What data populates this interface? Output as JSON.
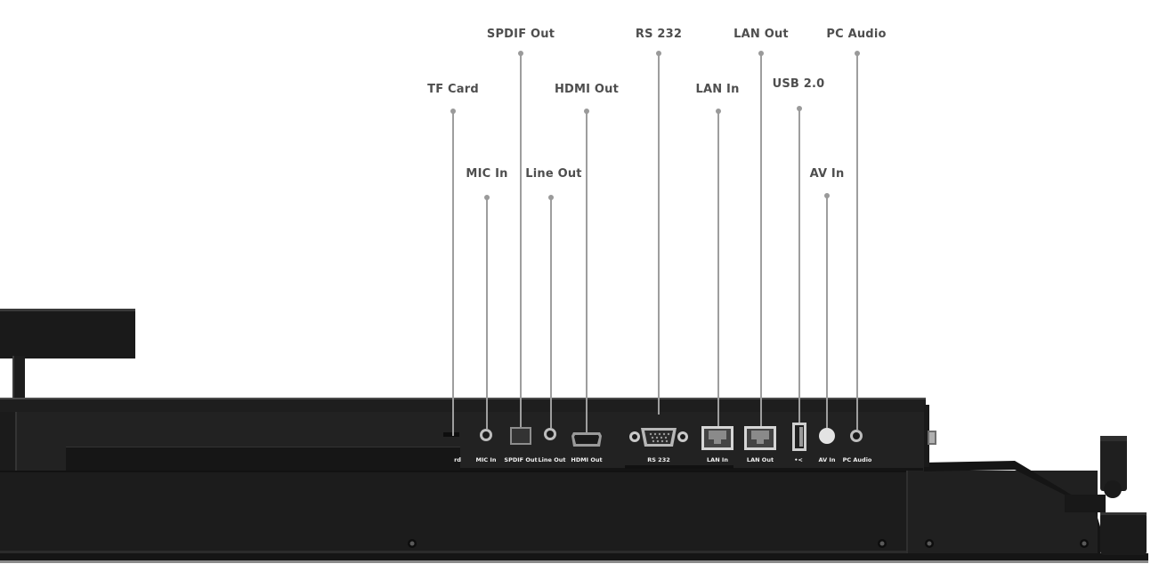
{
  "callouts": [
    {
      "id": "tf-card",
      "label": "TF Card"
    },
    {
      "id": "mic-in",
      "label": "MIC In"
    },
    {
      "id": "spdif-out",
      "label": "SPDIF Out"
    },
    {
      "id": "line-out",
      "label": "Line Out"
    },
    {
      "id": "hdmi-out",
      "label": "HDMI Out"
    },
    {
      "id": "rs-232",
      "label": "RS 232"
    },
    {
      "id": "lan-in",
      "label": "LAN In"
    },
    {
      "id": "lan-out",
      "label": "LAN Out"
    },
    {
      "id": "usb-2-0",
      "label": "USB 2.0"
    },
    {
      "id": "av-in",
      "label": "AV In"
    },
    {
      "id": "pc-audio",
      "label": "PC Audio"
    }
  ],
  "panel_labels": {
    "tf_card_partial": "rd",
    "mic_in": "MIC In",
    "spdif_out": "SPDIF Out",
    "line_out": "Line Out",
    "hdmi_out": "HDMI Out",
    "rs_232": "RS 232",
    "lan_in": "LAN In",
    "lan_out": "LAN Out",
    "usb_symbol": "•<",
    "av_in": "AV In",
    "pc_audio": "PC Audio"
  },
  "colors": {
    "callout_text": "#4e4e4e",
    "leader_line": "#9e9e9e",
    "chassis": "#1b1b1b",
    "panel": "#222222",
    "port_silver": "#c8c8c8"
  },
  "icons": [
    "usb-icon",
    "screw-icon"
  ]
}
